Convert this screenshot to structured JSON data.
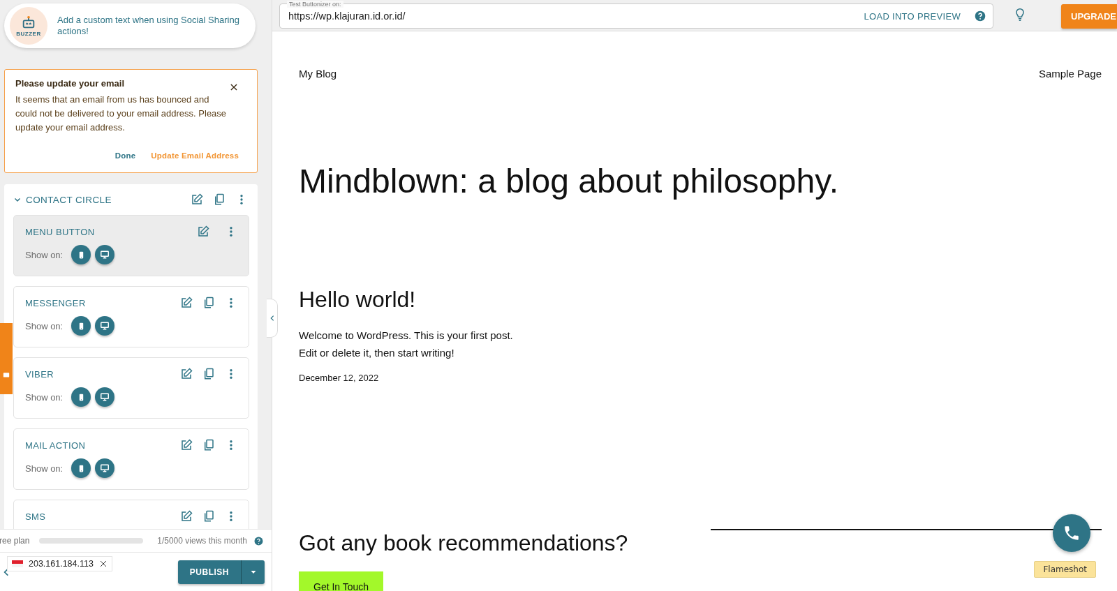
{
  "promo": {
    "logo_text": "BUZZER",
    "message": "Add a custom text when using Social Sharing actions!"
  },
  "notice": {
    "title": "Please update your email",
    "body": "It seems that an email from us has bounced and could not be delivered to your email address. Please update your email address.",
    "actions": [
      {
        "label": "Done",
        "kind": "secondary"
      },
      {
        "label": "Update Email Address",
        "kind": "primary"
      }
    ]
  },
  "group": {
    "title": "CONTACT CIRCLE",
    "expanded": true,
    "buttons": [
      {
        "title": "MENU BUTTON",
        "selected": true,
        "copyable": false,
        "show_on_label": "Show on:"
      },
      {
        "title": "MESSENGER",
        "selected": false,
        "copyable": true,
        "show_on_label": "Show on:"
      },
      {
        "title": "VIBER",
        "selected": false,
        "copyable": true,
        "show_on_label": "Show on:"
      },
      {
        "title": "MAIL ACTION",
        "selected": false,
        "copyable": true,
        "show_on_label": "Show on:"
      },
      {
        "title": "SMS",
        "selected": false,
        "copyable": true
      }
    ]
  },
  "plan": {
    "label": "ree plan",
    "level": 0,
    "usage": "1/5000 views this month"
  },
  "ip_chip": {
    "address": "203.161.184.113"
  },
  "publish": {
    "label": "PUBLISH"
  },
  "toolbar": {
    "field_label": "Test Buttonizer on:",
    "url": "https://wp.klajuran.id.or.id/",
    "load_label": "LOAD INTO PREVIEW",
    "upgrade_label": "UPGRADE"
  },
  "preview": {
    "site_title": "My Blog",
    "nav": [
      "Sample Page"
    ],
    "headline": "Mindblown: a blog about philosophy.",
    "post_title": "Hello world!",
    "post_lines": [
      "Welcome to WordPress. This is your first post.",
      "Edit or delete it, then start writing!"
    ],
    "post_date": "December 12, 2022",
    "cta_title": "Got any book recommendations?",
    "cta_button": "Get In Touch"
  },
  "tooltip": {
    "text": "Flameshot"
  }
}
